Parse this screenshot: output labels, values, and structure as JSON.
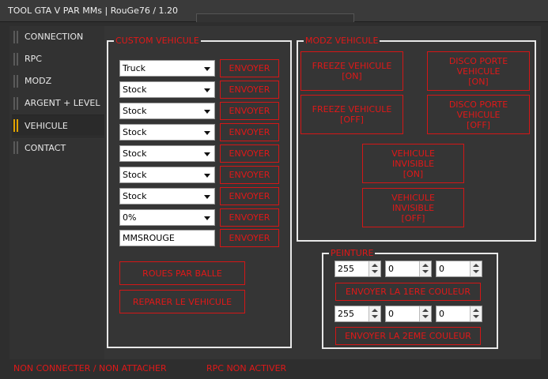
{
  "window": {
    "title": "TOOL GTA V PAR MMs | RouGe76 / 1.20"
  },
  "sidebar": {
    "items": [
      {
        "label": "CONNECTION"
      },
      {
        "label": "RPC"
      },
      {
        "label": "MODZ"
      },
      {
        "label": "ARGENT + LEVEL"
      },
      {
        "label": "VEHICULE",
        "active": true
      },
      {
        "label": "CONTACT"
      }
    ]
  },
  "custom": {
    "title": "CUSTOM VEHICULE",
    "selects": [
      "Truck",
      "Stock",
      "Stock",
      "Stock",
      "Stock",
      "Stock",
      "Stock",
      "0%"
    ],
    "plate": "MMSROUGE",
    "send_label": "ENVOYER",
    "wheels_label": "ROUES PAR BALLE",
    "repair_label": "REPARER LE VEHICULE"
  },
  "modz": {
    "title": "MODZ VEHICULE",
    "freeze_on": [
      "FREEZE VEHICULE",
      "[ON]"
    ],
    "disco_on": [
      "DISCO PORTE",
      "VEHICULE",
      "[ON]"
    ],
    "freeze_off": [
      "FREEZE VEHICULE",
      "[OFF]"
    ],
    "disco_off": [
      "DISCO PORTE",
      "VEHICULE",
      "[OFF]"
    ],
    "invis_on": [
      "VEHICULE",
      "INVISIBLE",
      "[ON]"
    ],
    "invis_off": [
      "VEHICULE",
      "INVISIBLE",
      "[OFF]"
    ]
  },
  "paint": {
    "title": "PEINTURE",
    "color1": [
      "255",
      "0",
      "0"
    ],
    "color2": [
      "255",
      "0",
      "0"
    ],
    "send1_label": "ENVOYER LA 1ERE COULEUR",
    "send2_label": "ENVOYER LA 2EME COULEUR"
  },
  "status": {
    "connection": "NON CONNECTER / NON ATTACHER",
    "rpc": "RPC NON ACTIVER"
  },
  "colors": {
    "accent_red": "#e01818",
    "active_marker": "#e0a300"
  }
}
